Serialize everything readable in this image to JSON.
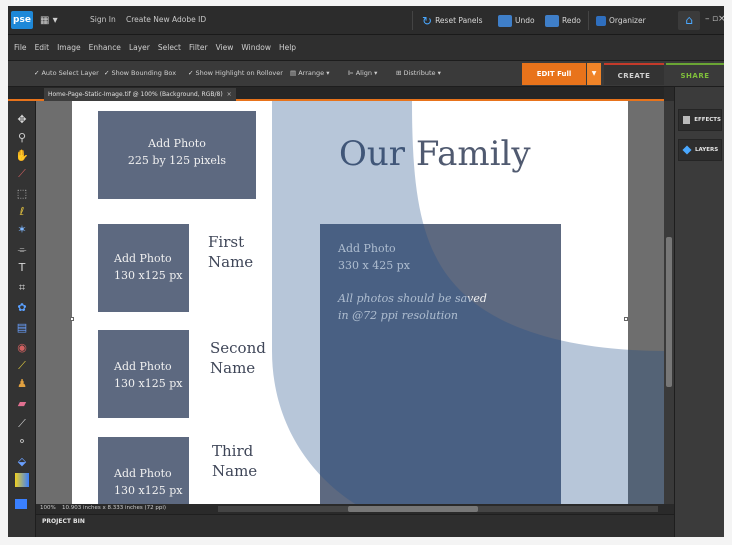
{
  "titlebar": {
    "logo": "pse",
    "sign_in": "Sign In",
    "create_id": "Create New Adobe ID",
    "reset_panels": "Reset Panels",
    "undo": "Undo",
    "redo": "Redo",
    "organizer": "Organizer"
  },
  "menu": [
    "File",
    "Edit",
    "Image",
    "Enhance",
    "Layer",
    "Select",
    "Filter",
    "View",
    "Window",
    "Help"
  ],
  "options": {
    "auto_select": "Auto Select Layer",
    "bounding_box": "Show Bounding Box",
    "highlight": "Show Highlight on Rollover",
    "arrange": "Arrange",
    "align": "Align",
    "distribute": "Distribute"
  },
  "modes": {
    "edit": "EDIT Full",
    "create": "CREATE",
    "share": "SHARE"
  },
  "document": {
    "tab_title": "Home-Page-Static-Image.tif @ 100% (Background, RGB/8)"
  },
  "canvas": {
    "title": "Our Family",
    "photo_large": {
      "line1": "Add Photo",
      "line2": "225 by 125 pixels"
    },
    "photo_1": {
      "line1": "Add Photo",
      "line2": "130 x125 px"
    },
    "photo_2": {
      "line1": "Add Photo",
      "line2": "130 x125 px"
    },
    "photo_3": {
      "line1": "Add Photo",
      "line2": "130 x125 px"
    },
    "name_1": {
      "line1": "First",
      "line2": "Name"
    },
    "name_2": {
      "line1": "Second",
      "line2": "Name"
    },
    "name_3": {
      "line1": "Third",
      "line2": "Name"
    },
    "photo_main": {
      "line1": "Add Photo",
      "line2": "330 x 425 px",
      "note1": "All photos should be saved",
      "note2": "in @72 ppi resolution"
    }
  },
  "panels": {
    "effects": "EFFECTS",
    "layers": "LAYERS"
  },
  "status": {
    "zoom": "100%",
    "size": "10.903 inches x 8.333 inches (72 ppi)"
  },
  "project_bin": "PROJECT BIN",
  "colors": {
    "accent_orange": "#e8731b",
    "placeholder_blue": "#5d6980",
    "share_green": "#7fbf3a"
  }
}
